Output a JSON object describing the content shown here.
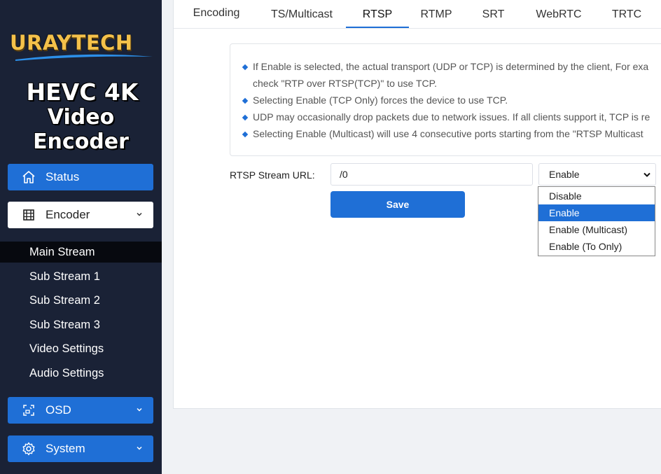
{
  "brand": {
    "logo_text": "URAYTECH",
    "product_line1": "HEVC 4K",
    "product_line2": "Video Encoder"
  },
  "sidebar": {
    "status": {
      "label": "Status",
      "icon": "home-icon"
    },
    "encoder": {
      "label": "Encoder",
      "icon": "film-icon"
    },
    "encoder_items": [
      "Main Stream",
      "Sub Stream 1",
      "Sub Stream 2",
      "Sub Stream 3",
      "Video Settings",
      "Audio Settings"
    ],
    "osd": {
      "label": "OSD",
      "icon": "osd-icon"
    },
    "system": {
      "label": "System",
      "icon": "gear-icon"
    }
  },
  "tabs": [
    "Encoding",
    "TS/Multicast",
    "RTSP",
    "RTMP",
    "SRT",
    "WebRTC",
    "TRTC"
  ],
  "active_tab": "RTSP",
  "info": [
    "If Enable is selected, the actual transport (UDP or TCP) is determined by the client, For exa",
    "check \"RTP over RTSP(TCP)\" to use TCP.",
    "Selecting Enable (TCP Only) forces the device to use TCP.",
    "UDP may occasionally drop packets due to network issues. If all clients support it, TCP is re",
    "Selecting Enable (Multicast) will use 4 consecutive ports starting from the \"RTSP Multicast"
  ],
  "form": {
    "url_label": "RTSP Stream URL:",
    "url_value": "/0",
    "select_value": "Enable",
    "options": [
      "Disable",
      "Enable",
      "Enable (Multicast)",
      "Enable (To Only)"
    ],
    "selected_option": "Enable",
    "save_label": "Save"
  },
  "colors": {
    "accent": "#1f6fd6",
    "sidebar_bg": "#1a2236",
    "logo_gold": "#f4c14a"
  }
}
